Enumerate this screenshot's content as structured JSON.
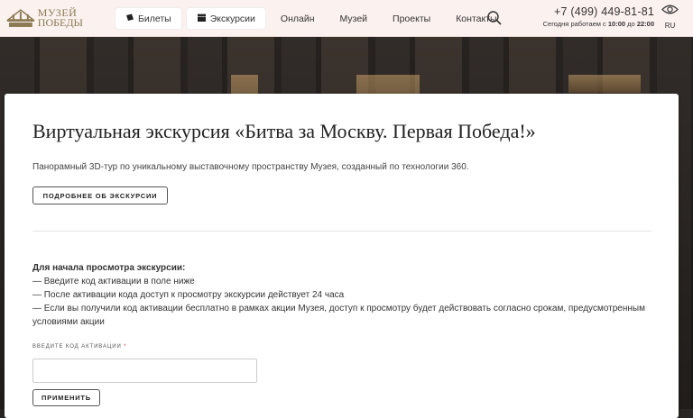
{
  "header": {
    "logo": {
      "line1": "МУЗЕЙ",
      "line2": "ПОБЕДЫ"
    },
    "nav": [
      {
        "label": "Билеты",
        "icon": "ticket-icon"
      },
      {
        "label": "Экскурсии",
        "icon": "people-icon"
      },
      {
        "label": "Онлайн"
      },
      {
        "label": "Музей"
      },
      {
        "label": "Проекты"
      },
      {
        "label": "Контакты"
      }
    ],
    "search_icon": "search-icon",
    "phone": "+7 (499) 449-81-81",
    "hours_prefix": "Сегодня работаем с",
    "hours_from": "10:00",
    "hours_mid": "до",
    "hours_to": "22:00",
    "accessibility_icon": "eye-icon",
    "lang": "RU"
  },
  "main": {
    "title": "Виртуальная экскурсия «Битва за Москву. Первая Победа!»",
    "subtitle": "Панорамный 3D-тур по уникальному выставочному пространству Музея, созданный по технологии 360.",
    "more_button": "ПОДРОБНЕЕ ОБ ЭКСКУРСИИ",
    "instructions": {
      "heading": "Для начала просмотра экскурсии:",
      "items": [
        "— Введите код активации в поле ниже",
        "— После активации кода доступ к просмотру экскурсии действует 24 часа",
        "— Если вы получили код активации бесплатно в рамках акции Музея, доступ к просмотру будет действовать согласно срокам, предусмотренным условиями акции"
      ]
    },
    "code_label": "ВВЕДИТЕ КОД АКТИВАЦИИ",
    "code_required_mark": "*",
    "code_value": "",
    "apply_button": "ПРИМЕНИТЬ"
  },
  "colors": {
    "header_bg": "#fbf1ef",
    "logo_gold": "#8c7a52",
    "card_bg": "#ffffff"
  }
}
